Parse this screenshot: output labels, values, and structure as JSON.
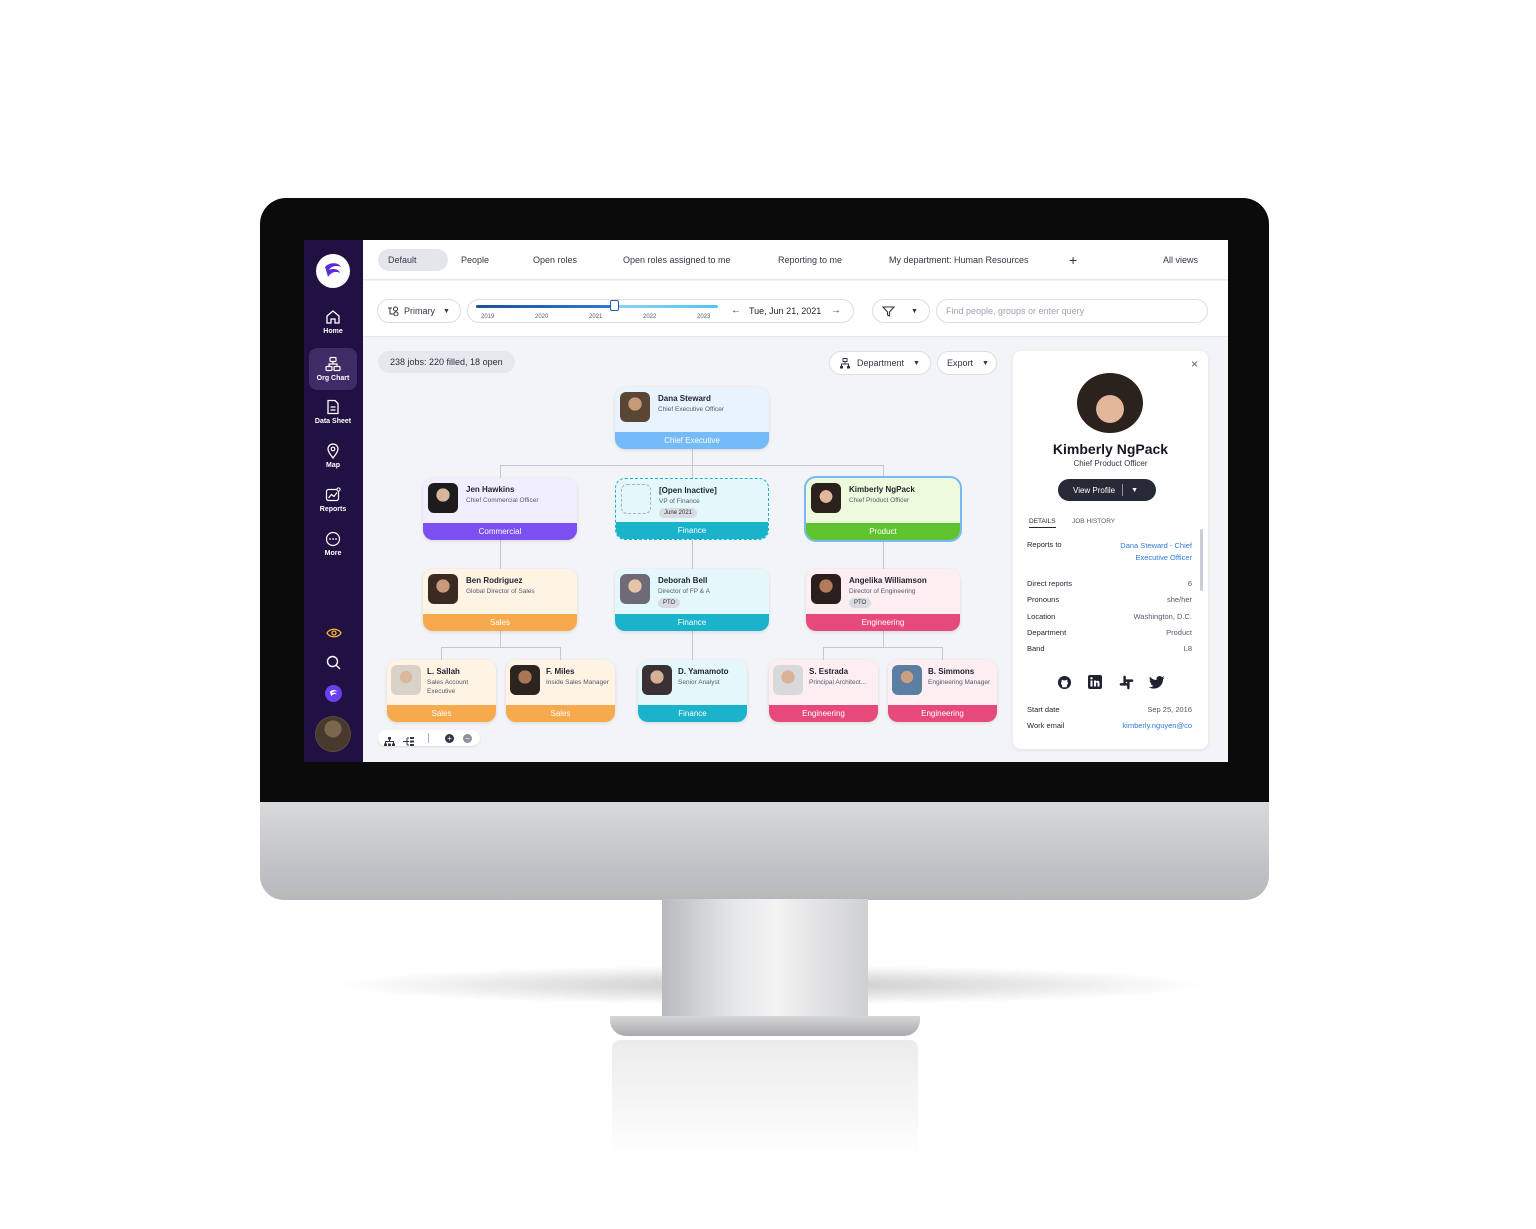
{
  "sidebar": {
    "items": [
      {
        "label": "Home",
        "icon": "home-icon"
      },
      {
        "label": "Org Chart",
        "icon": "org-chart-icon"
      },
      {
        "label": "Data Sheet",
        "icon": "data-sheet-icon"
      },
      {
        "label": "Map",
        "icon": "map-pin-icon"
      },
      {
        "label": "Reports",
        "icon": "reports-icon"
      },
      {
        "label": "More",
        "icon": "more-icon"
      }
    ],
    "bottom_icons": [
      "eye-icon",
      "search-icon",
      "app-logo-icon",
      "user-avatar"
    ]
  },
  "tabs": [
    "Default",
    "People",
    "Open roles",
    "Open roles assigned to me",
    "Reporting to me",
    "My department: Human Resources"
  ],
  "all_views": "All views",
  "add_tab": "+",
  "toolbar": {
    "primary": "Primary",
    "years": [
      "2019",
      "2020",
      "2021",
      "2022",
      "2023"
    ],
    "date": "Tue, Jun 21, 2021",
    "search_placeholder": "Find people, groups or enter query"
  },
  "canvas": {
    "count": "238 jobs: 220 filled, 18 open",
    "department_btn": "Department",
    "export_btn": "Export"
  },
  "cards": [
    {
      "name": "Dana Steward",
      "title": "Chief Executive Officer",
      "dept": "Chief Executive",
      "tag": ""
    },
    {
      "name": "Jen Hawkins",
      "title": "Chief Commercial Officer",
      "dept": "Commercial",
      "tag": ""
    },
    {
      "name": "[Open Inactive]",
      "title": "VP of Finance",
      "dept": "Finance",
      "tag": "June 2021"
    },
    {
      "name": "Kimberly NgPack",
      "title": "Chief Product Officer",
      "dept": "Product",
      "tag": ""
    },
    {
      "name": "Ben Rodriguez",
      "title": "Global Director of Sales",
      "dept": "Sales",
      "tag": ""
    },
    {
      "name": "Deborah Bell",
      "title": "Director of FP & A",
      "dept": "Finance",
      "tag": "PTO"
    },
    {
      "name": "Angelika Williamson",
      "title": "Director of Engineering",
      "dept": "Engineering",
      "tag": "PTO"
    },
    {
      "name": "L. Sallah",
      "title": "Sales Account Executive",
      "dept": "Sales",
      "tag": ""
    },
    {
      "name": "F. Miles",
      "title": "Inside Sales Manager",
      "dept": "Sales",
      "tag": ""
    },
    {
      "name": "D. Yamamoto",
      "title": "Senior Analyst",
      "dept": "Finance",
      "tag": ""
    },
    {
      "name": "S. Estrada",
      "title": "Principal Architect...",
      "dept": "Engineering",
      "tag": ""
    },
    {
      "name": "B. Simmons",
      "title": "Engineering Manager",
      "dept": "Engineering",
      "tag": ""
    }
  ],
  "panel": {
    "name": "Kimberly NgPack",
    "role": "Chief Product Officer",
    "view_profile": "View Profile",
    "tabs": [
      "DETAILS",
      "JOB HISTORY"
    ],
    "details": [
      {
        "label": "Reports to",
        "value": "Dana Steward - Chief Executive Officer"
      },
      {
        "label": "Direct reports",
        "value": "6"
      },
      {
        "label": "Pronouns",
        "value": "she/her"
      },
      {
        "label": "Location",
        "value": "Washington, D.C."
      },
      {
        "label": "Department",
        "value": "Product"
      },
      {
        "label": "Band",
        "value": "L8"
      },
      {
        "label": "Start date",
        "value": "Sep 25, 2016"
      },
      {
        "label": "Work email",
        "value": "kimberly.nguyen@co"
      }
    ],
    "social": [
      "github-icon",
      "linkedin-icon",
      "slack-icon",
      "twitter-icon"
    ]
  },
  "colors": {
    "sidebar": "#211142",
    "chief_executive": "#74bbf7",
    "commercial": "#7b4ff0",
    "finance": "#1ab3cb",
    "product": "#5fc330",
    "sales": "#f7a94d",
    "engineering": "#e64a7b"
  }
}
